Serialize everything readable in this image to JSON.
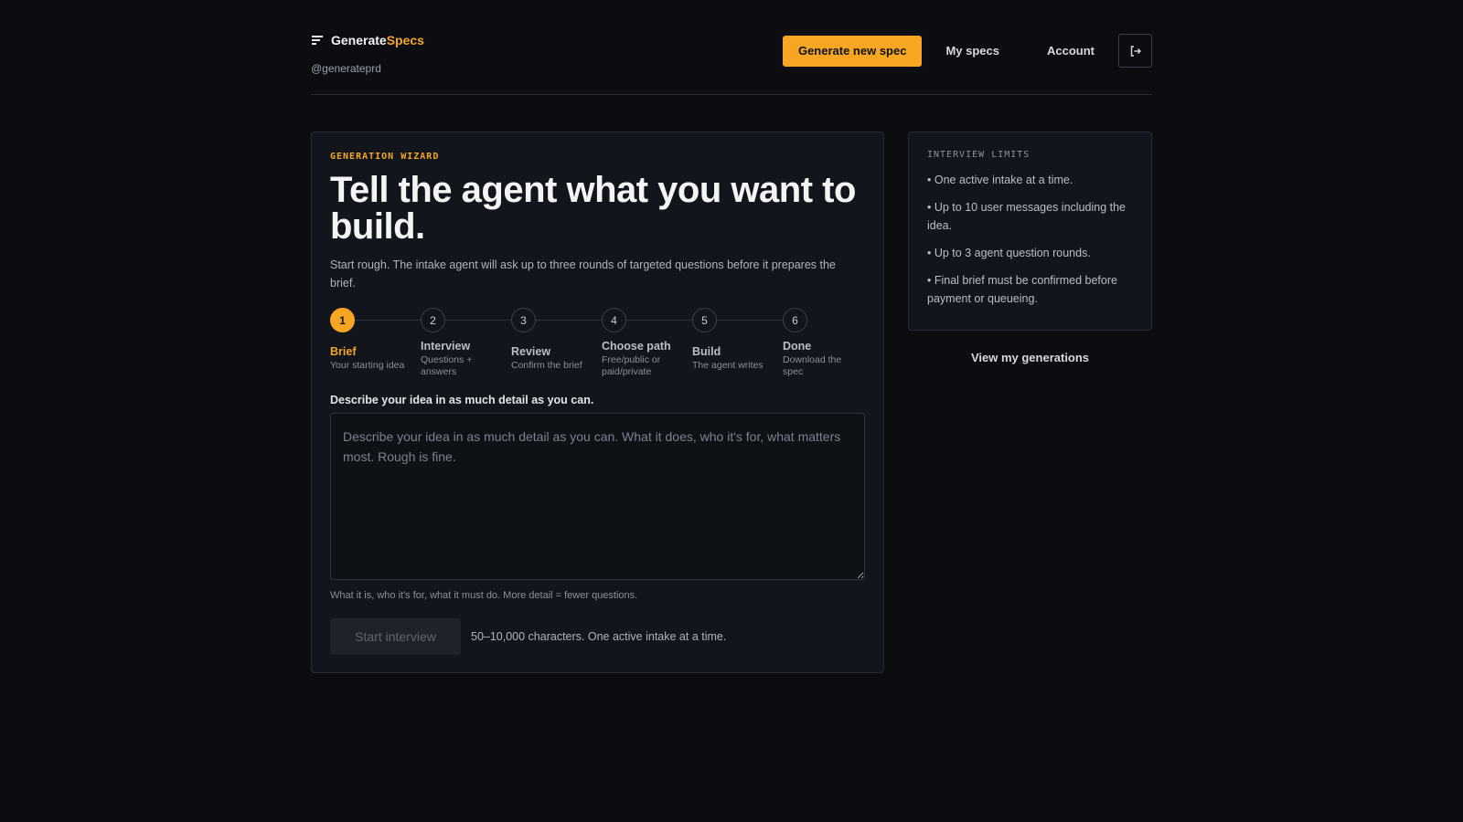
{
  "brand": {
    "name_main": "Generate",
    "name_accent": "Specs",
    "handle": "@generateprd"
  },
  "nav": {
    "generate_label": "Generate new spec",
    "my_specs_label": "My specs",
    "account_label": "Account",
    "logout_icon": "logout-icon"
  },
  "wizard": {
    "eyebrow": "GENERATION WIZARD",
    "title": "Tell the agent what you want to build.",
    "subtitle": "Start rough. The intake agent will ask up to three rounds of targeted questions before it prepares the brief.",
    "steps": [
      {
        "number": "1",
        "label": "Brief",
        "sub": "Your starting idea"
      },
      {
        "number": "2",
        "label": "Interview",
        "sub": "Questions + answers"
      },
      {
        "number": "3",
        "label": "Review",
        "sub": "Confirm the brief"
      },
      {
        "number": "4",
        "label": "Choose path",
        "sub": "Free/public or paid/private"
      },
      {
        "number": "5",
        "label": "Build",
        "sub": "The agent writes"
      },
      {
        "number": "6",
        "label": "Done",
        "sub": "Download the spec"
      }
    ],
    "active_step": 1,
    "field_label": "Describe your idea in as much detail as you can.",
    "placeholder": "Describe your idea in as much detail as you can. What it does, who it's for, what matters most. Rough is fine.",
    "hint": "What it is, who it's for, what it must do. More detail = fewer questions.",
    "start_button": "Start interview",
    "start_note": "50–10,000 characters. One active intake at a time."
  },
  "limits": {
    "title": "INTERVIEW LIMITS",
    "items": [
      "• One active intake at a time.",
      "• Up to 10 user messages including the idea.",
      "• Up to 3 agent question rounds.",
      "• Final brief must be confirmed before payment or queueing."
    ],
    "link": "View my generations"
  },
  "colors": {
    "accent": "#f7a623",
    "background": "#0b0d11",
    "card": "#12151b"
  }
}
